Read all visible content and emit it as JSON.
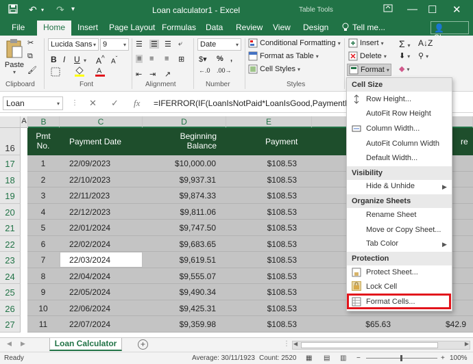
{
  "window": {
    "title": "Loan calculator1 - Excel",
    "context_tab": "Table Tools"
  },
  "ribbon_tabs": {
    "file": "File",
    "home": "Home",
    "insert": "Insert",
    "page_layout": "Page Layout",
    "formulas": "Formulas",
    "data": "Data",
    "review": "Review",
    "view": "View",
    "design": "Design",
    "tell_me": "Tell me...",
    "share": "Share"
  },
  "ribbon": {
    "paste": "Paste",
    "clipboard_label": "Clipboard",
    "font_name": "Lucida Sans",
    "font_size": "9",
    "font_label": "Font",
    "alignment_label": "Alignment",
    "number_format": "Date",
    "number_label": "Number",
    "conditional_formatting": "Conditional Formatting",
    "format_as_table": "Format as Table",
    "cell_styles": "Cell Styles",
    "styles_label": "Styles",
    "insert": "Insert",
    "delete": "Delete",
    "format": "Format"
  },
  "formula_bar": {
    "name_box": "Loan",
    "formula": "=IFERROR(IF(LoanIsNotPaid*LoanIsGood,PaymentDa"
  },
  "columns": [
    "A",
    "B",
    "C",
    "D",
    "E"
  ],
  "table_header": {
    "pmt_no": "Pmt No.",
    "payment_date": "Payment Date",
    "beginning_balance": "Beginning Balance",
    "payment": "Payment",
    "partial_last": "re"
  },
  "rows": [
    {
      "row": "17",
      "pmt": "1",
      "date": "22/09/2023",
      "balance": "$10,000.00",
      "payment": "$108.53"
    },
    {
      "row": "18",
      "pmt": "2",
      "date": "22/10/2023",
      "balance": "$9,937.31",
      "payment": "$108.53"
    },
    {
      "row": "19",
      "pmt": "3",
      "date": "22/11/2023",
      "balance": "$9,874.33",
      "payment": "$108.53"
    },
    {
      "row": "20",
      "pmt": "4",
      "date": "22/12/2023",
      "balance": "$9,811.06",
      "payment": "$108.53"
    },
    {
      "row": "21",
      "pmt": "5",
      "date": "22/01/2024",
      "balance": "$9,747.50",
      "payment": "$108.53"
    },
    {
      "row": "22",
      "pmt": "6",
      "date": "22/02/2024",
      "balance": "$9,683.65",
      "payment": "$108.53"
    },
    {
      "row": "23",
      "pmt": "7",
      "date": "22/03/2024",
      "balance": "$9,619.51",
      "payment": "$108.53"
    },
    {
      "row": "24",
      "pmt": "8",
      "date": "22/04/2024",
      "balance": "$9,555.07",
      "payment": "$108.53"
    },
    {
      "row": "25",
      "pmt": "9",
      "date": "22/05/2024",
      "balance": "$9,490.34",
      "payment": "$108.53"
    },
    {
      "row": "26",
      "pmt": "10",
      "date": "22/06/2024",
      "balance": "$9,425.31",
      "payment": "$108.53"
    },
    {
      "row": "27",
      "pmt": "11",
      "date": "22/07/2024",
      "balance": "$9,359.98",
      "payment": "$108.53",
      "extra": "$65.63",
      "extra2": "$42.9"
    }
  ],
  "header_row_num": "16",
  "sheet_tab": "Loan Calculator",
  "status": {
    "ready": "Ready",
    "average": "Average: 30/11/1923",
    "count": "Count: 2520",
    "zoom": "100%"
  },
  "format_menu": {
    "cell_size": "Cell Size",
    "row_height": "Row Height...",
    "autofit_row": "AutoFit Row Height",
    "column_width": "Column Width...",
    "autofit_column": "AutoFit Column Width",
    "default_width": "Default Width...",
    "visibility": "Visibility",
    "hide_unhide": "Hide & Unhide",
    "organize_sheets": "Organize Sheets",
    "rename_sheet": "Rename Sheet",
    "move_copy": "Move or Copy Sheet...",
    "tab_color": "Tab Color",
    "protection": "Protection",
    "protect_sheet": "Protect Sheet...",
    "lock_cell": "Lock Cell",
    "format_cells": "Format Cells..."
  },
  "colors": {
    "excel_green": "#217346",
    "table_header": "#1e4e2c",
    "highlight_red": "#e2141b"
  }
}
